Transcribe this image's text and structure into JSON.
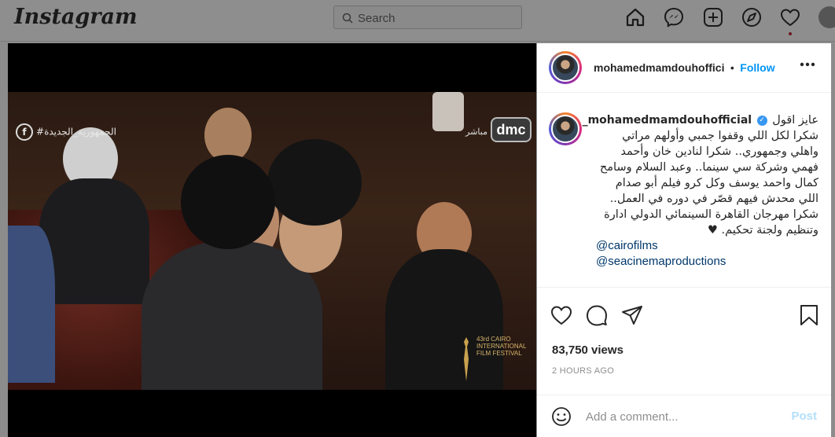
{
  "topbar": {
    "logo": "Instagram",
    "search_placeholder": "Search",
    "icons": [
      "home-icon",
      "messenger-icon",
      "new-post-icon",
      "explore-icon",
      "activity-heart-icon",
      "profile-avatar"
    ]
  },
  "video": {
    "watermark_left": "#الجمهورية_الجديدة",
    "channel_logo": "dmc",
    "live_label": "مباشر",
    "festival_text": "43rd CAIRO INTERNATIONAL FILM FESTIVAL"
  },
  "post": {
    "header": {
      "username": "mohamedmamdouhoffici",
      "separator": "•",
      "follow_label": "Follow"
    },
    "caption": {
      "username": "mohamedmamdouhofficial_",
      "lines": [
        "عايز اقول",
        "شكرا لكل اللي وقفوا جمبي وأولهم مراتي",
        "واهلي وجمهوري.. شكرا لنادين خان وأحمد",
        "فهمي وشركة سي سينما.. وعبد السلام وسامح",
        "كمال واحمد يوسف وكل كرو فيلم أبو صدام",
        "اللي محدش فيهم قصّر في دوره في العمل..",
        "شكرا مهرجان القاهرة السينمائي الدولي ادارة",
        "وتنظيم ولجنة تحكيم. ♥"
      ],
      "mentions": [
        "@cairofilms",
        "@seacinemaproductions"
      ]
    },
    "views": "83,750 views",
    "time": "2 HOURS AGO",
    "comment_placeholder": "Add a comment...",
    "post_label": "Post"
  },
  "colors": {
    "follow": "#0095f6",
    "mention": "#00376b",
    "post_disabled": "#b2dffc",
    "verified": "#3897f0"
  }
}
